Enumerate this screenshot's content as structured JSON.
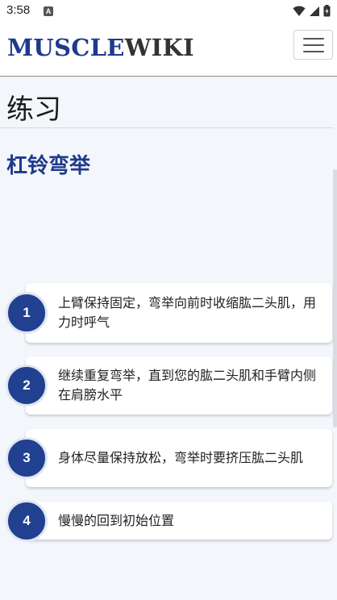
{
  "status_bar": {
    "time": "3:58",
    "notification_icon": "A",
    "icons": [
      "wifi-icon",
      "signal-icon",
      "battery-icon"
    ]
  },
  "header": {
    "logo_part1": "MUSCLE",
    "logo_part2": "WIKI",
    "menu_icon": "hamburger-menu-icon"
  },
  "page": {
    "section_title": "练习",
    "exercise_title": "杠铃弯举"
  },
  "steps": [
    {
      "number": "1",
      "text": "上臂保持固定，弯举向前时收缩肱二头肌，用力时呼气"
    },
    {
      "number": "2",
      "text": "继续重复弯举，直到您的肱二头肌和手臂内侧在肩膀水平"
    },
    {
      "number": "3",
      "text": "身体尽量保持放松，弯举时要挤压肱二头肌"
    },
    {
      "number": "4",
      "text": "慢慢的回到初始位置"
    }
  ],
  "colors": {
    "brand_blue": "#1e3a8a",
    "step_circle": "#21408f",
    "background": "#f3f6fa"
  }
}
